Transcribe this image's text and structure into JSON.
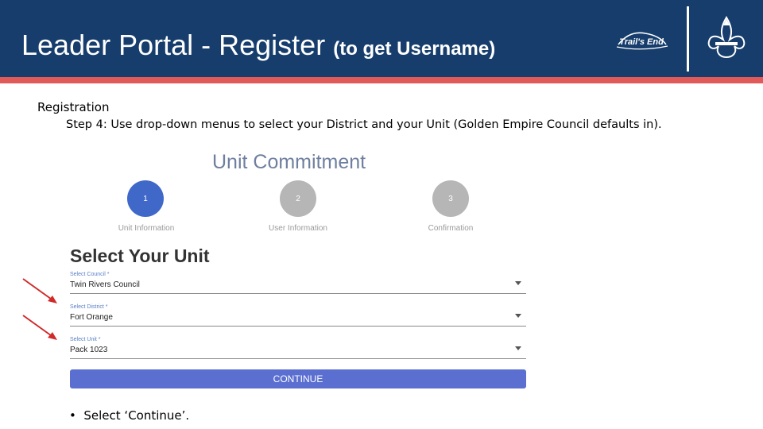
{
  "header": {
    "title_main": "Leader Portal - Register",
    "title_sub": "(to get Username)",
    "logo_text": "Trail's End"
  },
  "content": {
    "heading": "Registration",
    "step_text": "Step 4: Use drop-down menus to select your District and your Unit (Golden Empire Council defaults in).",
    "bullet_text": "Select ‘Continue’."
  },
  "screenshot": {
    "title": "Unit Commitment",
    "steps": [
      {
        "number": "1",
        "label": "Unit Information",
        "active": true
      },
      {
        "number": "2",
        "label": "User Information",
        "active": false
      },
      {
        "number": "3",
        "label": "Confirmation",
        "active": false
      }
    ],
    "section_title": "Select Your Unit",
    "fields": [
      {
        "label": "Select Council *",
        "value": "Twin Rivers Council"
      },
      {
        "label": "Select District *",
        "value": "Fort Orange"
      },
      {
        "label": "Select Unit *",
        "value": "Pack 1023"
      }
    ],
    "continue_label": "CONTINUE"
  },
  "colors": {
    "header_bg": "#163d6c",
    "stripe": "#e05a5a",
    "step_active": "#3f68c9",
    "step_inactive": "#b6b6b6",
    "button": "#5a6fd0",
    "arrow": "#d12a2a"
  }
}
